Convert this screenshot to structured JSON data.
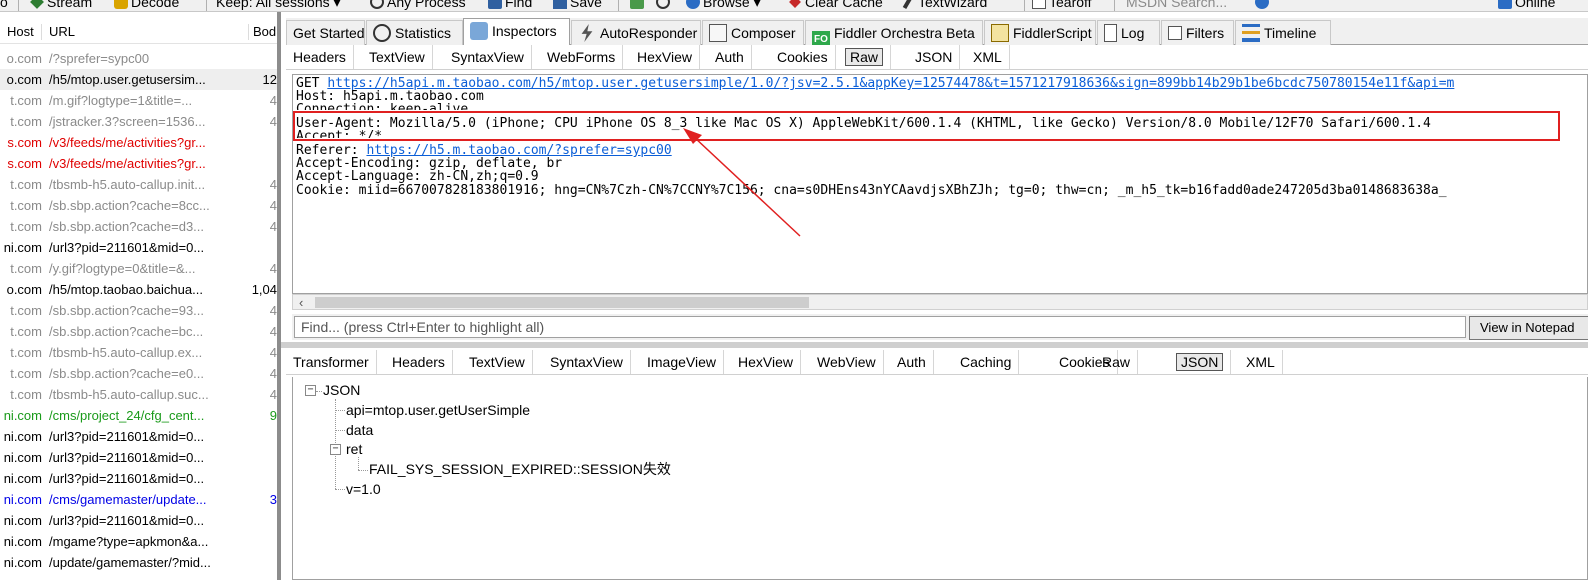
{
  "toolbar": {
    "items": [
      {
        "label": "Stream"
      },
      {
        "label": "Decode"
      },
      {
        "label": "Keep: All sessions"
      },
      {
        "label": "Any Process"
      },
      {
        "label": "Find"
      },
      {
        "label": "Save"
      },
      {
        "label": "Browse"
      },
      {
        "label": "Clear Cache"
      },
      {
        "label": "TextWizard"
      },
      {
        "label": "Tearoff"
      },
      {
        "label": "MSDN Search..."
      },
      {
        "label": "Online"
      }
    ]
  },
  "sessions": {
    "columns": {
      "host": "Host",
      "url": "URL",
      "body": "Bod"
    },
    "rows": [
      {
        "host": "o.com",
        "url": "/?sprefer=sypc00",
        "body": "",
        "color": "gray"
      },
      {
        "host": "o.com",
        "url": "/h5/mtop.user.getusersim...",
        "body": "12",
        "color": "black"
      },
      {
        "host": "t.com",
        "url": "/m.gif?logtype=1&title=...",
        "body": "4",
        "color": "gray"
      },
      {
        "host": "t.com",
        "url": "/jstracker.3?screen=1536...",
        "body": "4",
        "color": "gray"
      },
      {
        "host": "s.com",
        "url": "/v3/feeds/me/activities?gr...",
        "body": "",
        "color": "red"
      },
      {
        "host": "s.com",
        "url": "/v3/feeds/me/activities?gr...",
        "body": "",
        "color": "red"
      },
      {
        "host": "t.com",
        "url": "/tbsmb-h5.auto-callup.init...",
        "body": "4",
        "color": "gray"
      },
      {
        "host": "t.com",
        "url": "/sb.sbp.action?cache=8cc...",
        "body": "4",
        "color": "gray"
      },
      {
        "host": "t.com",
        "url": "/sb.sbp.action?cache=d3...",
        "body": "4",
        "color": "gray"
      },
      {
        "host": "ni.com",
        "url": "/url3?pid=211601&mid=0...",
        "body": "",
        "color": "black"
      },
      {
        "host": "t.com",
        "url": "/y.gif?logtype=0&title=&...",
        "body": "4",
        "color": "gray"
      },
      {
        "host": "o.com",
        "url": "/h5/mtop.taobao.baichua...",
        "body": "1,04",
        "color": "black"
      },
      {
        "host": "t.com",
        "url": "/sb.sbp.action?cache=93...",
        "body": "4",
        "color": "gray"
      },
      {
        "host": "t.com",
        "url": "/sb.sbp.action?cache=bc...",
        "body": "4",
        "color": "gray"
      },
      {
        "host": "t.com",
        "url": "/tbsmb-h5.auto-callup.ex...",
        "body": "4",
        "color": "gray"
      },
      {
        "host": "t.com",
        "url": "/sb.sbp.action?cache=e0...",
        "body": "4",
        "color": "gray"
      },
      {
        "host": "t.com",
        "url": "/tbsmb-h5.auto-callup.suc...",
        "body": "4",
        "color": "gray"
      },
      {
        "host": "ni.com",
        "url": "/cms/project_24/cfg_cent...",
        "body": "9",
        "color": "green"
      },
      {
        "host": "ni.com",
        "url": "/url3?pid=211601&mid=0...",
        "body": "",
        "color": "black"
      },
      {
        "host": "ni.com",
        "url": "/url3?pid=211601&mid=0...",
        "body": "",
        "color": "black"
      },
      {
        "host": "ni.com",
        "url": "/url3?pid=211601&mid=0...",
        "body": "",
        "color": "black"
      },
      {
        "host": "ni.com",
        "url": "/cms/gamemaster/update...",
        "body": "3",
        "color": "blue"
      },
      {
        "host": "ni.com",
        "url": "/url3?pid=211601&mid=0...",
        "body": "",
        "color": "black"
      },
      {
        "host": "ni.com",
        "url": "/mgame?type=apkmon&a...",
        "body": "",
        "color": "black"
      },
      {
        "host": "ni.com",
        "url": "/update/gamemaster/?mid...",
        "body": "",
        "color": "black"
      }
    ]
  },
  "inspector_tabs": [
    {
      "label": "Get Started"
    },
    {
      "label": "Statistics"
    },
    {
      "label": "Inspectors"
    },
    {
      "label": "AutoResponder"
    },
    {
      "label": "Composer"
    },
    {
      "label": "Fiddler Orchestra Beta"
    },
    {
      "label": "FiddlerScript"
    },
    {
      "label": "Log"
    },
    {
      "label": "Filters"
    },
    {
      "label": "Timeline"
    }
  ],
  "request_tabs": [
    "Headers",
    "TextView",
    "SyntaxView",
    "WebForms",
    "HexView",
    "Auth",
    "Cookies",
    "Raw",
    "JSON",
    "XML"
  ],
  "request_raw": {
    "get_prefix": "GET ",
    "get_url": "https://h5api.m.taobao.com/h5/mtop.user.getusersimple/1.0/?jsv=2.5.1&appKey=12574478&t=1571217918636&sign=899bb14b29b1be6bcdc750780154e11f&api=m",
    "host": "Host: h5api.m.taobao.com",
    "connection": "Connection: keep-alive",
    "user_agent": "User-Agent: Mozilla/5.0 (iPhone; CPU iPhone OS 8_3 like Mac OS X) AppleWebKit/600.1.4 (KHTML, like Gecko) Version/8.0 Mobile/12F70 Safari/600.1.4",
    "accept": "Accept: */*",
    "referer_prefix": "Referer: ",
    "referer_url": "https://h5.m.taobao.com/?sprefer=sypc00",
    "accept_encoding": "Accept-Encoding: gzip, deflate, br",
    "accept_language": "Accept-Language: zh-CN,zh;q=0.9",
    "cookie": "Cookie: miid=667007828183801916; hng=CN%7Czh-CN%7CCNY%7C156; cna=s0DHEns43nYCAavdjsXBhZJh; tg=0; thw=cn; _m_h5_tk=b16fadd0ade247205d3ba0148683638a_"
  },
  "find": {
    "placeholder": "Find... (press Ctrl+Enter to highlight all)",
    "button": "View in Notepad"
  },
  "response_tabs": [
    "Transformer",
    "Headers",
    "TextView",
    "SyntaxView",
    "ImageView",
    "HexView",
    "WebView",
    "Auth",
    "Caching",
    "Cookies",
    "Raw",
    "JSON",
    "XML"
  ],
  "response_json": {
    "root": "JSON",
    "api": "api=mtop.user.getUserSimple",
    "data": "data",
    "ret": "ret",
    "ret_value": "FAIL_SYS_SESSION_EXPIRED::SESSION失效",
    "v": "v=1.0"
  },
  "colors": {
    "highlight": "#e02020",
    "link": "#0b5ed7"
  }
}
